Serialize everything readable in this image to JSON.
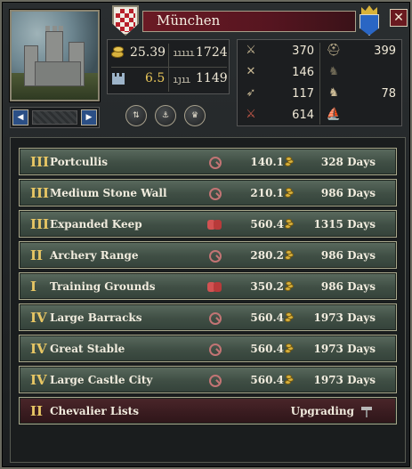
{
  "window": {
    "title": "München"
  },
  "stats": {
    "gold": "25.39",
    "levy": "1724",
    "defense": "6.5",
    "garrison": "1149"
  },
  "troops": [
    {
      "icon": "light-infantry-icon",
      "value": "370"
    },
    {
      "icon": "heavy-infantry-icon",
      "value": "399"
    },
    {
      "icon": "pikemen-icon",
      "value": "146"
    },
    {
      "icon": "light-cavalry-icon",
      "value": ""
    },
    {
      "icon": "archers-icon",
      "value": "117"
    },
    {
      "icon": "knights-icon",
      "value": "78"
    },
    {
      "icon": "total-troops-icon",
      "value": "614"
    },
    {
      "icon": "galleys-icon",
      "value": ""
    }
  ],
  "buildings": [
    {
      "level": "III",
      "name": "Portcullis",
      "cost": "140.1",
      "time": "328 Days",
      "prereq": "magnifier"
    },
    {
      "level": "III",
      "name": "Medium Stone Wall",
      "cost": "210.1",
      "time": "986 Days",
      "prereq": "magnifier"
    },
    {
      "level": "III",
      "name": "Expanded Keep",
      "cost": "560.4",
      "time": "1315 Days",
      "prereq": "blocked"
    },
    {
      "level": "II",
      "name": "Archery Range",
      "cost": "280.2",
      "time": "986 Days",
      "prereq": "magnifier"
    },
    {
      "level": "I",
      "name": "Training Grounds",
      "cost": "350.2",
      "time": "986 Days",
      "prereq": "blocked"
    },
    {
      "level": "IV",
      "name": "Large Barracks",
      "cost": "560.4",
      "time": "1973 Days",
      "prereq": "magnifier"
    },
    {
      "level": "IV",
      "name": "Great Stable",
      "cost": "560.4",
      "time": "1973 Days",
      "prereq": "magnifier"
    },
    {
      "level": "IV",
      "name": "Large Castle City",
      "cost": "560.4",
      "time": "1973 Days",
      "prereq": "magnifier"
    }
  ],
  "upgrading": {
    "level": "II",
    "name": "Chevalier Lists",
    "status": "Upgrading"
  },
  "colors": {
    "title_bar": "#6a1a24",
    "row_green": "#4a5a4e",
    "row_upgrading": "#3a1c20",
    "gold_text": "#e8c65a"
  }
}
